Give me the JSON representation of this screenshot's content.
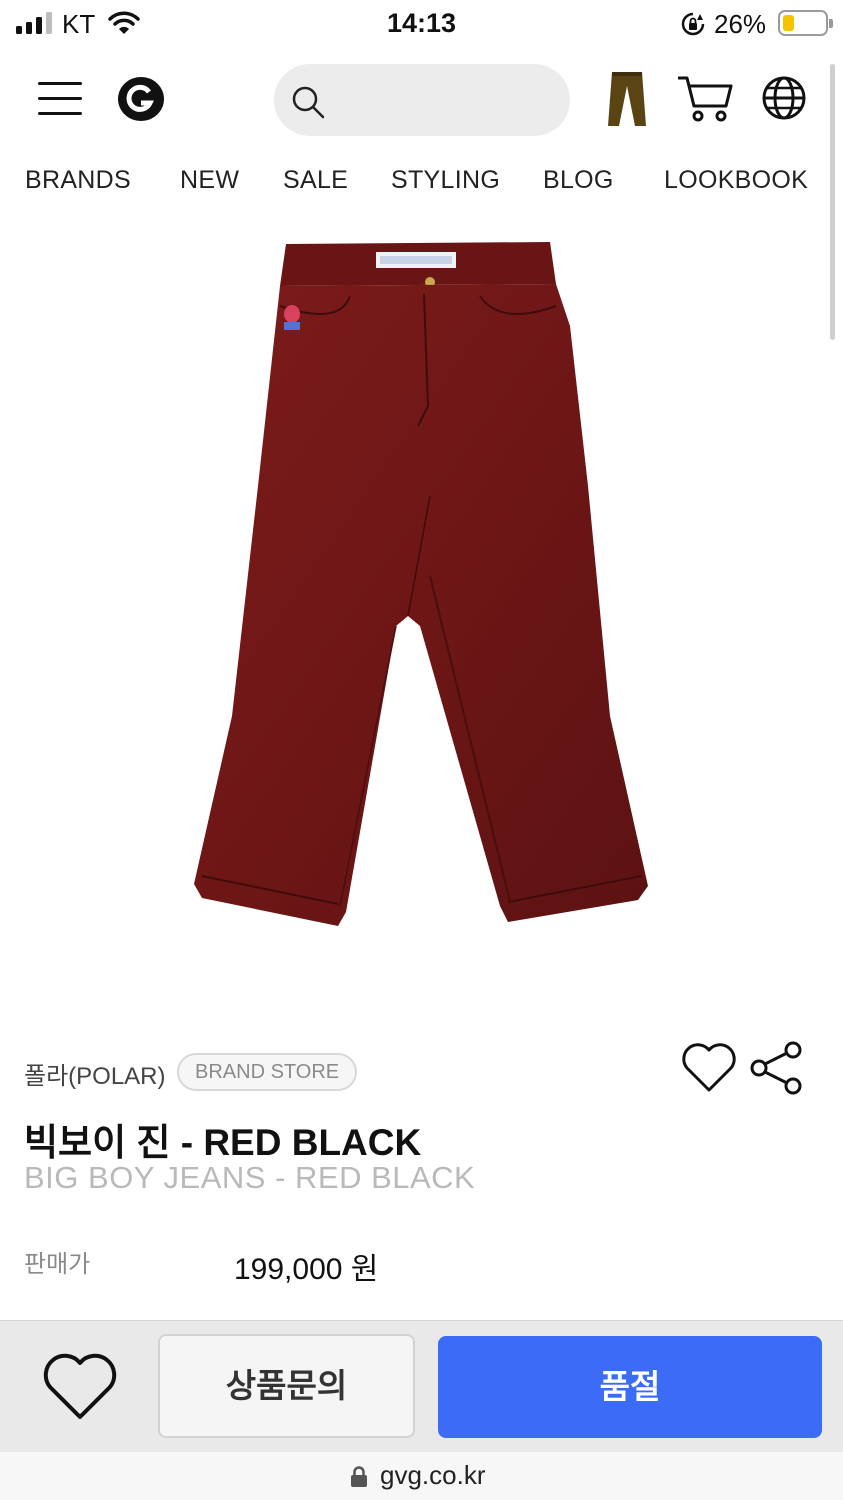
{
  "status_bar": {
    "carrier": "KT",
    "time": "14:13",
    "battery_percent": "26%",
    "battery_level": 0.26,
    "battery_color": "#f5c400"
  },
  "header": {
    "menu_icon": "hamburger-menu-icon",
    "logo_icon": "gvg-logo-icon",
    "search_placeholder": "",
    "search_icon": "search-icon",
    "recent_item_icon": "pants-thumbnail-icon",
    "cart_icon": "cart-icon",
    "globe_icon": "globe-icon"
  },
  "nav": {
    "items": [
      "BRANDS",
      "NEW",
      "SALE",
      "STYLING",
      "BLOG",
      "LOOKBOOK"
    ]
  },
  "product": {
    "brand": "폴라(POLAR)",
    "brand_badge": "BRAND STORE",
    "title_kr": "빅보이 진 - RED BLACK",
    "title_en": "BIG BOY JEANS - RED BLACK",
    "price_label": "판매가",
    "price": "199,000 원",
    "image_icon": "red-jeans-image",
    "color_main": "#7a1a1a"
  },
  "actions": {
    "wishlist_icon": "heart-icon",
    "share_icon": "share-icon",
    "inquiry_label": "상품문의",
    "soldout_label": "품절",
    "accent_color": "#3c6cf5"
  },
  "browser": {
    "url": "gvg.co.kr",
    "lock_icon": "lock-icon"
  }
}
